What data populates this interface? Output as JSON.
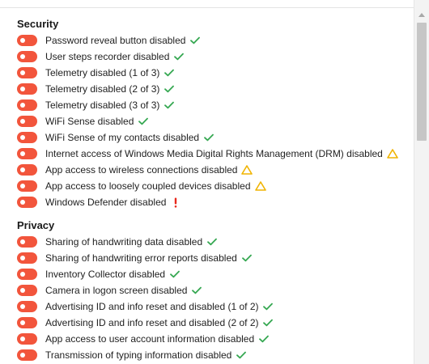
{
  "colors": {
    "toggle_off": "#f2553c",
    "ok": "#36a852",
    "warning": "#f0b400",
    "error": "#e8281c"
  },
  "sections": [
    {
      "title": "Security",
      "items": [
        {
          "label": "Password reveal button disabled",
          "status": "check-icon"
        },
        {
          "label": "User steps recorder disabled",
          "status": "check-icon"
        },
        {
          "label": "Telemetry disabled (1 of 3)",
          "status": "check-icon"
        },
        {
          "label": "Telemetry disabled (2 of 3)",
          "status": "check-icon"
        },
        {
          "label": "Telemetry disabled (3 of 3)",
          "status": "check-icon"
        },
        {
          "label": "WiFi Sense disabled",
          "status": "check-icon"
        },
        {
          "label": "WiFi Sense of my contacts disabled",
          "status": "check-icon"
        },
        {
          "label": "Internet access of Windows Media Digital Rights Management (DRM) disabled",
          "status": "warning-icon"
        },
        {
          "label": "App access to wireless connections disabled",
          "status": "warning-icon"
        },
        {
          "label": "App access to loosely coupled devices disabled",
          "status": "warning-icon"
        },
        {
          "label": "Windows Defender disabled",
          "status": "exclamation-icon"
        }
      ]
    },
    {
      "title": "Privacy",
      "items": [
        {
          "label": "Sharing of handwriting data disabled",
          "status": "check-icon"
        },
        {
          "label": "Sharing of handwriting error reports disabled",
          "status": "check-icon"
        },
        {
          "label": "Inventory Collector disabled",
          "status": "check-icon"
        },
        {
          "label": "Camera in logon screen disabled",
          "status": "check-icon"
        },
        {
          "label": "Advertising ID and info reset and disabled (1 of 2)",
          "status": "check-icon"
        },
        {
          "label": "Advertising ID and info reset and disabled (2 of 2)",
          "status": "check-icon"
        },
        {
          "label": "App access to user account information disabled",
          "status": "check-icon"
        },
        {
          "label": "Transmission of typing information disabled",
          "status": "check-icon"
        }
      ]
    }
  ]
}
